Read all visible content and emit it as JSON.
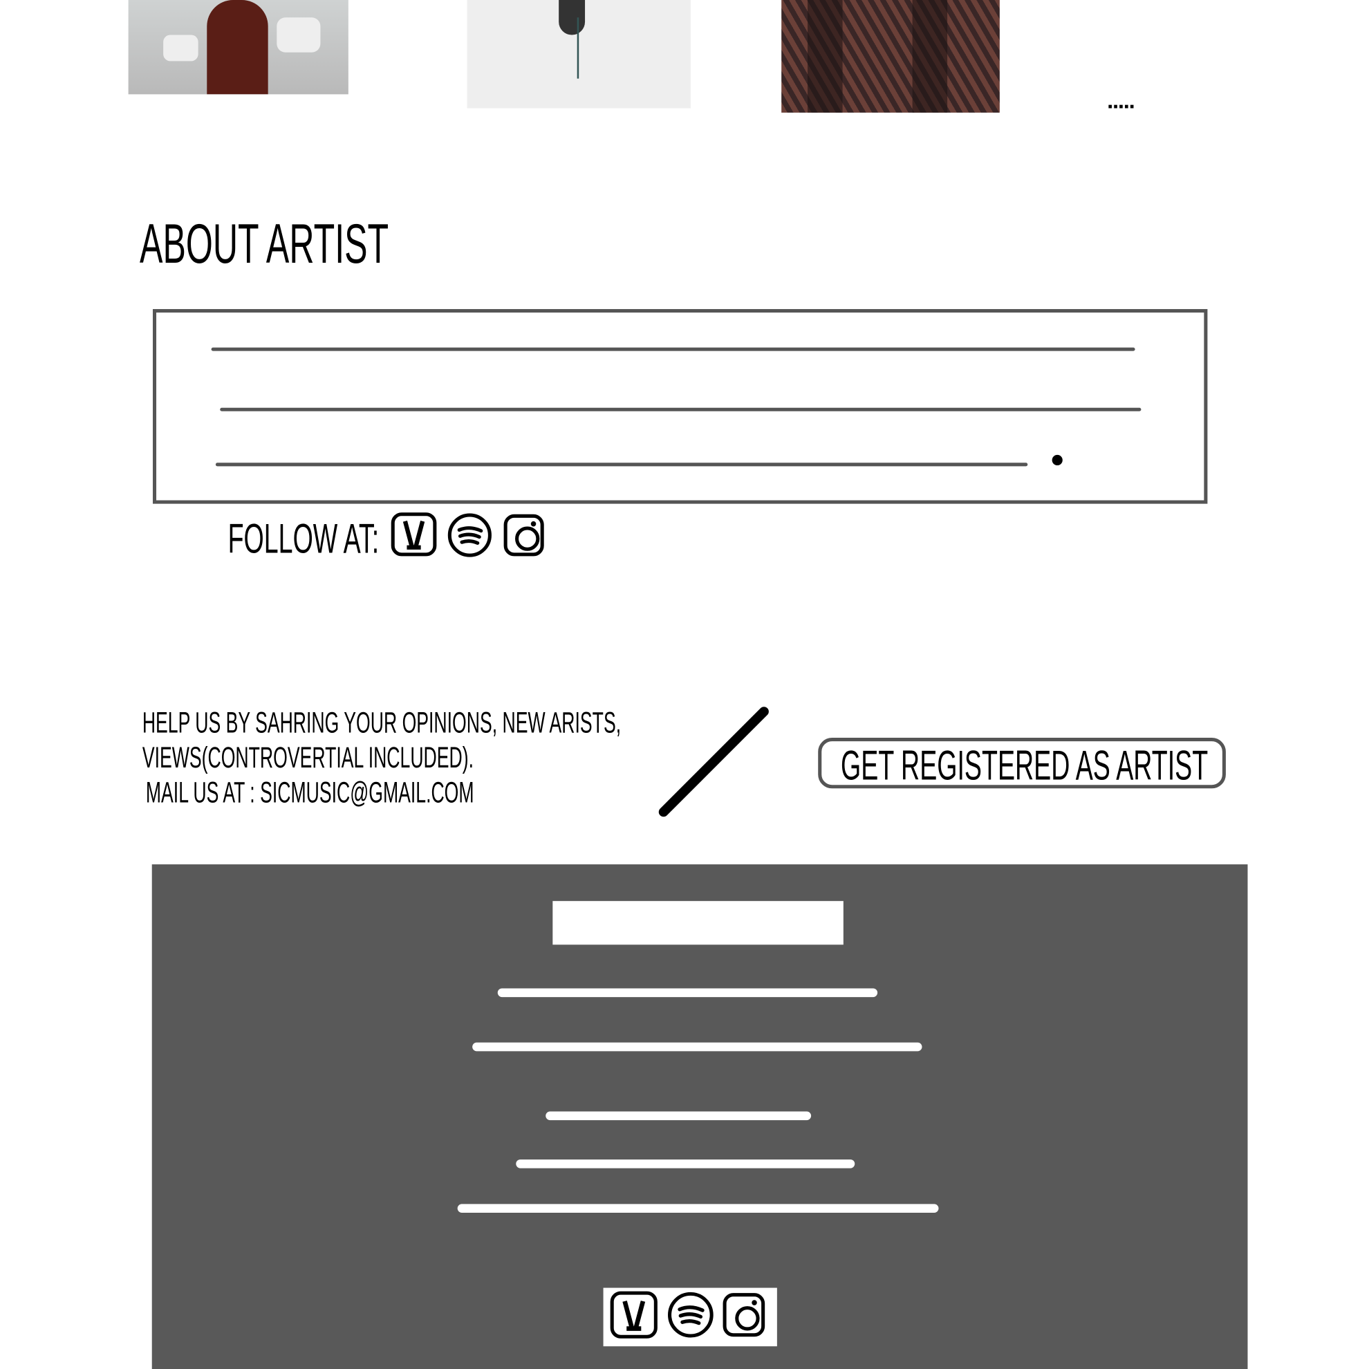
{
  "gallery": {
    "items": [
      {
        "name": "album-art-1",
        "colors": [
          "#c9c9c9",
          "#5a1e16"
        ]
      },
      {
        "name": "album-art-2",
        "colors": [
          "#eeeeee",
          "#333333"
        ]
      },
      {
        "name": "album-art-3",
        "colors": [
          "#6b4038",
          "#2a1c1c"
        ]
      }
    ],
    "more_label": "....."
  },
  "about": {
    "title": "ABOUT ARTIST",
    "follow_label": "FOLLOW AT:",
    "social_icons": [
      "jiosaavn-icon",
      "spotify-icon",
      "instagram-icon"
    ]
  },
  "contact": {
    "line1": "HELP US BY SAHRING YOUR OPINIONS, NEW ARISTS,",
    "line2": "VIEWS(CONTROVERTIAL INCLUDED).",
    "line3": "MAIL US AT : SICMUSIC@GMAIL.COM",
    "register_button": "GET REGISTERED AS ARTIST"
  },
  "colors": {
    "footer_bg": "#595959",
    "border": "#555555"
  }
}
